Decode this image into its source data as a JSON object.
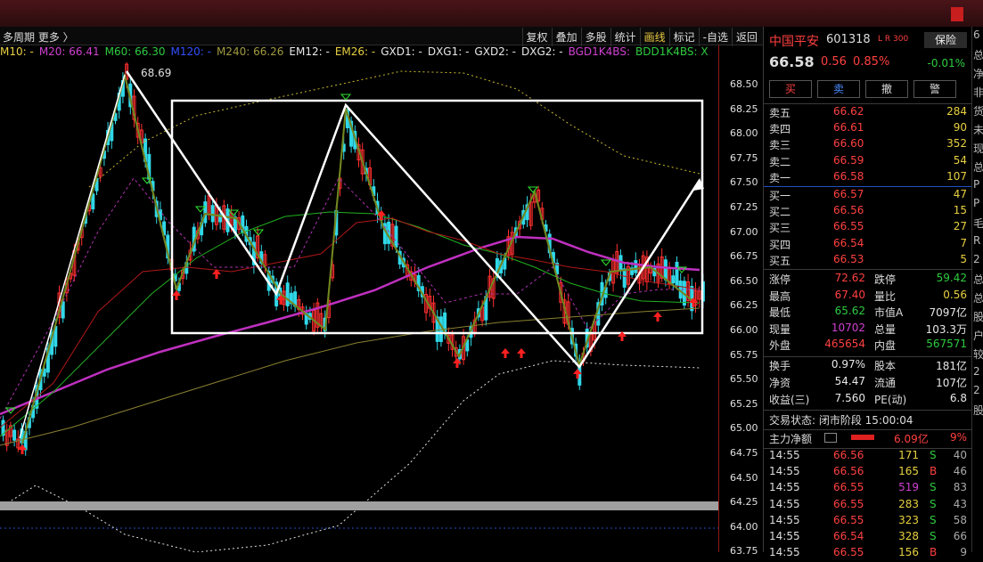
{
  "toolbar": {
    "left_text": "多周期  更多 〉",
    "buttons": [
      "复权",
      "叠加",
      "多股",
      "统计",
      "画线",
      "标记",
      "-自选",
      "返回"
    ],
    "active": "画线"
  },
  "ma_bar": [
    {
      "text": "M10: -",
      "color": "#e8d040"
    },
    {
      "text": "M20: 66.41",
      "color": "#d040d0"
    },
    {
      "text": "M60: 66.30",
      "color": "#2ecc40"
    },
    {
      "text": "M120: -",
      "color": "#3050ff"
    },
    {
      "text": "M240: 66.26",
      "color": "#a09a40"
    },
    {
      "text": "EM12: -",
      "color": "#e8e8e8"
    },
    {
      "text": "EM26: -",
      "color": "#e8d040"
    },
    {
      "text": "GXD1: -",
      "color": "#e8e8e8"
    },
    {
      "text": "DXG1: -",
      "color": "#e8e8e8"
    },
    {
      "text": "GXD2: -",
      "color": "#e8e8e8"
    },
    {
      "text": "DXG2: -",
      "color": "#e8e8e8"
    },
    {
      "text": "BGD1K4BS:",
      "color": "#d040d0"
    },
    {
      "text": "BDD1K4BS: X",
      "color": "#2ecc40"
    }
  ],
  "chart": {
    "peak_label": "68.69",
    "y_ticks": [
      "68.50",
      "68.25",
      "68.00",
      "67.75",
      "67.50",
      "67.25",
      "67.00",
      "66.75",
      "66.50",
      "66.25",
      "66.00",
      "65.75",
      "65.50",
      "65.25",
      "65.00",
      "64.75",
      "64.50",
      "64.25",
      "64.00",
      "63.75"
    ]
  },
  "quote": {
    "name": "中国平安",
    "code": "601318",
    "tag": "L R 300",
    "type_btn": "保险",
    "type_change": "-0.01%",
    "price": "66.58",
    "change": "0.56",
    "pct": "0.85%",
    "buttons": [
      "买",
      "卖",
      "撤",
      "警"
    ],
    "asks": [
      {
        "label": "卖五",
        "price": "66.62",
        "vol": "284"
      },
      {
        "label": "卖四",
        "price": "66.61",
        "vol": "90"
      },
      {
        "label": "卖三",
        "price": "66.60",
        "vol": "352"
      },
      {
        "label": "卖二",
        "price": "66.59",
        "vol": "54"
      },
      {
        "label": "卖一",
        "price": "66.58",
        "vol": "107"
      }
    ],
    "bids": [
      {
        "label": "买一",
        "price": "66.57",
        "vol": "47"
      },
      {
        "label": "买二",
        "price": "66.56",
        "vol": "15"
      },
      {
        "label": "买三",
        "price": "66.55",
        "vol": "27"
      },
      {
        "label": "买四",
        "price": "66.54",
        "vol": "7"
      },
      {
        "label": "买五",
        "price": "66.53",
        "vol": "5"
      }
    ],
    "stats": [
      {
        "l1": "涨停",
        "v1": "72.62",
        "c1": "red",
        "l2": "跌停",
        "v2": "59.42",
        "c2": "green"
      },
      {
        "l1": "最高",
        "v1": "67.40",
        "c1": "red",
        "l2": "量比",
        "v2": "0.56",
        "c2": "yellow"
      },
      {
        "l1": "最低",
        "v1": "65.62",
        "c1": "green",
        "l2": "市值A",
        "v2": "7097亿",
        "c2": "white"
      },
      {
        "l1": "现量",
        "v1": "10702",
        "c1": "magenta",
        "l2": "总量",
        "v2": "103.3万",
        "c2": "white"
      },
      {
        "l1": "外盘",
        "v1": "465654",
        "c1": "red",
        "l2": "内盘",
        "v2": "567571",
        "c2": "green"
      }
    ],
    "stats2": [
      {
        "l1": "换手",
        "v1": "0.97%",
        "l2": "股本",
        "v2": "181亿"
      },
      {
        "l1": "净资",
        "v1": "54.47",
        "l2": "流通",
        "v2": "107亿"
      },
      {
        "l1": "收益(三)",
        "v1": "7.560",
        "l2": "PE(动)",
        "v2": "6.8"
      }
    ],
    "status_label": "交易状态: 闭市阶段 15:00:04",
    "main_flow_label": "主力净额",
    "main_flow_value": "6.09亿",
    "main_flow_pct": "9%",
    "ticks": [
      {
        "t": "14:55",
        "p": "66.56",
        "v": "171",
        "s": "S",
        "n": "40",
        "vc": "yellow"
      },
      {
        "t": "14:55",
        "p": "66.56",
        "v": "165",
        "s": "B",
        "n": "46",
        "vc": "yellow"
      },
      {
        "t": "14:55",
        "p": "66.55",
        "v": "519",
        "s": "S",
        "n": "83",
        "vc": "magenta"
      },
      {
        "t": "14:55",
        "p": "66.55",
        "v": "283",
        "s": "S",
        "n": "43",
        "vc": "yellow"
      },
      {
        "t": "14:55",
        "p": "66.55",
        "v": "323",
        "s": "S",
        "n": "58",
        "vc": "yellow"
      },
      {
        "t": "14:55",
        "p": "66.54",
        "v": "328",
        "s": "S",
        "n": "66",
        "vc": "yellow"
      },
      {
        "t": "14:55",
        "p": "66.55",
        "v": "156",
        "s": "B",
        "n": "9",
        "vc": "yellow"
      }
    ]
  },
  "edge": [
    "6",
    "总",
    "净",
    "非",
    "货",
    "未",
    "现",
    "总",
    "P",
    "P",
    "毛",
    "R",
    "2",
    "总",
    "总",
    "股",
    "户",
    "较",
    "2",
    "2",
    "股"
  ]
}
